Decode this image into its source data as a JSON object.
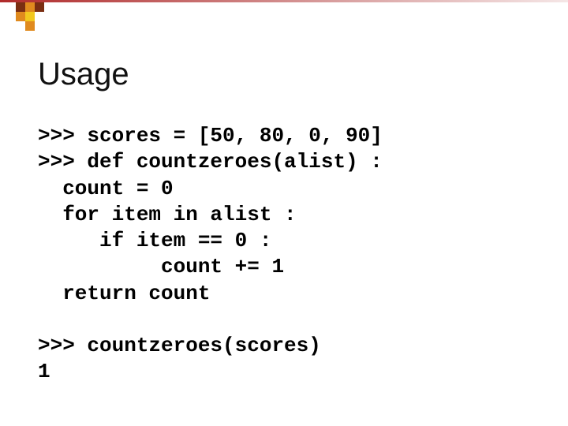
{
  "heading": "Usage",
  "code": {
    "l1": ">>> scores = [50, 80, 0, 90]",
    "l2": ">>> def countzeroes(alist) :",
    "l3": "  count = 0",
    "l4": "  for item in alist :",
    "l5": "     if item == 0 :",
    "l6": "          count += 1",
    "l7": "  return count",
    "l8": "",
    "l9": ">>> countzeroes(scores)",
    "l10": "1"
  },
  "decor": {
    "c_dark": "#7a2e12",
    "c_orange": "#e08a1e",
    "c_yellow": "#f2c81e"
  }
}
